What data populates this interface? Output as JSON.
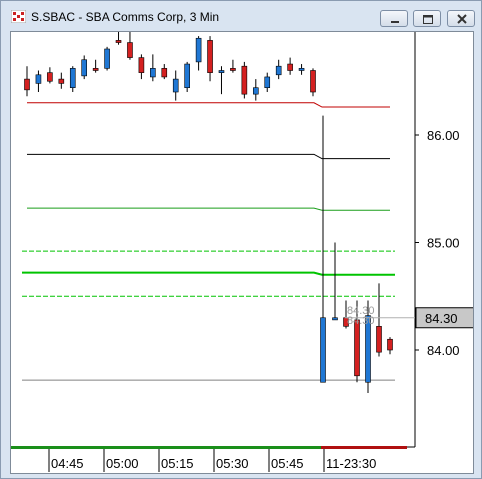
{
  "window": {
    "title": "S.SBAC - SBA Comms Corp, 3 Min",
    "icon": "chart-app-icon",
    "controls": [
      "minimize-icon",
      "maximize-icon",
      "close-icon"
    ]
  },
  "colors": {
    "up_candle": "#1f77d4",
    "down_candle": "#d42020",
    "red_line": "#c00000",
    "black_line": "#000000",
    "green_line": "#1a9e1a",
    "bright_green": "#00c400",
    "gray_line": "#808080",
    "last_price_box": "#c8c8c8",
    "volume_bar_green": "#1a8f1a",
    "volume_bar_red": "#b01010"
  },
  "chart_data": {
    "type": "candlestick",
    "y_axis": {
      "ticks": [
        "86.00",
        "85.00",
        "84.00"
      ],
      "range": [
        83.1,
        87.1
      ]
    },
    "x_axis": {
      "ticks": [
        "04:45",
        "05:00",
        "05:15",
        "05:30",
        "05:45",
        "11-23:30"
      ]
    },
    "last_price": "84.30",
    "overlay_labels": [
      "84.30",
      "84.30"
    ],
    "candles": [
      {
        "o": 86.52,
        "h": 86.64,
        "l": 86.36,
        "c": 86.42,
        "dir": "down"
      },
      {
        "o": 86.48,
        "h": 86.6,
        "l": 86.4,
        "c": 86.56,
        "dir": "up"
      },
      {
        "o": 86.58,
        "h": 86.63,
        "l": 86.48,
        "c": 86.5,
        "dir": "down"
      },
      {
        "o": 86.48,
        "h": 86.58,
        "l": 86.43,
        "c": 86.52,
        "dir": "down"
      },
      {
        "o": 86.44,
        "h": 86.64,
        "l": 86.4,
        "c": 86.62,
        "dir": "up"
      },
      {
        "o": 86.55,
        "h": 86.74,
        "l": 86.52,
        "c": 86.7,
        "dir": "up"
      },
      {
        "o": 86.62,
        "h": 86.7,
        "l": 86.58,
        "c": 86.6,
        "dir": "down"
      },
      {
        "o": 86.62,
        "h": 86.82,
        "l": 86.6,
        "c": 86.8,
        "dir": "up"
      },
      {
        "o": 86.88,
        "h": 87.02,
        "l": 86.84,
        "c": 86.86,
        "dir": "down"
      },
      {
        "o": 86.86,
        "h": 86.96,
        "l": 86.7,
        "c": 86.72,
        "dir": "down"
      },
      {
        "o": 86.72,
        "h": 86.75,
        "l": 86.52,
        "c": 86.58,
        "dir": "down"
      },
      {
        "o": 86.54,
        "h": 86.75,
        "l": 86.5,
        "c": 86.62,
        "dir": "up"
      },
      {
        "o": 86.62,
        "h": 86.66,
        "l": 86.52,
        "c": 86.54,
        "dir": "down"
      },
      {
        "o": 86.4,
        "h": 86.6,
        "l": 86.32,
        "c": 86.52,
        "dir": "up"
      },
      {
        "o": 86.44,
        "h": 86.68,
        "l": 86.4,
        "c": 86.66,
        "dir": "up"
      },
      {
        "o": 86.68,
        "h": 86.92,
        "l": 86.6,
        "c": 86.9,
        "dir": "up"
      },
      {
        "o": 86.88,
        "h": 86.92,
        "l": 86.5,
        "c": 86.58,
        "dir": "down"
      },
      {
        "o": 86.58,
        "h": 86.64,
        "l": 86.38,
        "c": 86.6,
        "dir": "up"
      },
      {
        "o": 86.62,
        "h": 86.7,
        "l": 86.58,
        "c": 86.6,
        "dir": "down"
      },
      {
        "o": 86.64,
        "h": 86.68,
        "l": 86.34,
        "c": 86.38,
        "dir": "down"
      },
      {
        "o": 86.38,
        "h": 86.52,
        "l": 86.32,
        "c": 86.44,
        "dir": "up"
      },
      {
        "o": 86.44,
        "h": 86.58,
        "l": 86.4,
        "c": 86.54,
        "dir": "up"
      },
      {
        "o": 86.56,
        "h": 86.7,
        "l": 86.52,
        "c": 86.64,
        "dir": "up"
      },
      {
        "o": 86.66,
        "h": 86.72,
        "l": 86.56,
        "c": 86.6,
        "dir": "down"
      },
      {
        "o": 86.6,
        "h": 86.66,
        "l": 86.56,
        "c": 86.62,
        "dir": "up"
      },
      {
        "o": 86.6,
        "h": 86.62,
        "l": 86.36,
        "c": 86.4,
        "dir": "down"
      },
      {
        "o": 83.7,
        "h": 86.18,
        "l": 83.7,
        "c": 84.3,
        "dir": "up"
      },
      {
        "o": 84.28,
        "h": 85.0,
        "l": 84.28,
        "c": 84.3,
        "dir": "up"
      },
      {
        "o": 84.3,
        "h": 84.46,
        "l": 84.2,
        "c": 84.22,
        "dir": "down"
      },
      {
        "o": 84.28,
        "h": 84.46,
        "l": 83.7,
        "c": 83.76,
        "dir": "down"
      },
      {
        "o": 83.7,
        "h": 84.46,
        "l": 83.6,
        "c": 84.32,
        "dir": "up"
      },
      {
        "o": 84.22,
        "h": 84.62,
        "l": 83.94,
        "c": 83.98,
        "dir": "down"
      },
      {
        "o": 84.1,
        "h": 84.12,
        "l": 83.96,
        "c": 84.0,
        "dir": "down"
      }
    ],
    "levels": [
      {
        "name": "red-level",
        "color": "red",
        "pre": 86.3,
        "post": 86.26,
        "style": "solid"
      },
      {
        "name": "black-level",
        "color": "black",
        "pre": 85.82,
        "post": 85.78,
        "style": "solid"
      },
      {
        "name": "green-level",
        "color": "green",
        "pre": 85.32,
        "post": 85.3,
        "style": "solid"
      },
      {
        "name": "green-dashed-upper",
        "color": "bright_green",
        "pre": 84.92,
        "post": 84.92,
        "style": "dashed"
      },
      {
        "name": "green-main",
        "color": "bright_green",
        "pre": 84.72,
        "post": 84.7,
        "style": "solid-thick"
      },
      {
        "name": "green-dashed-lower",
        "color": "bright_green",
        "pre": 84.5,
        "post": 84.5,
        "style": "dashed"
      },
      {
        "name": "gray-level",
        "color": "gray",
        "pre": 83.72,
        "post": 83.72,
        "style": "solid"
      }
    ]
  }
}
